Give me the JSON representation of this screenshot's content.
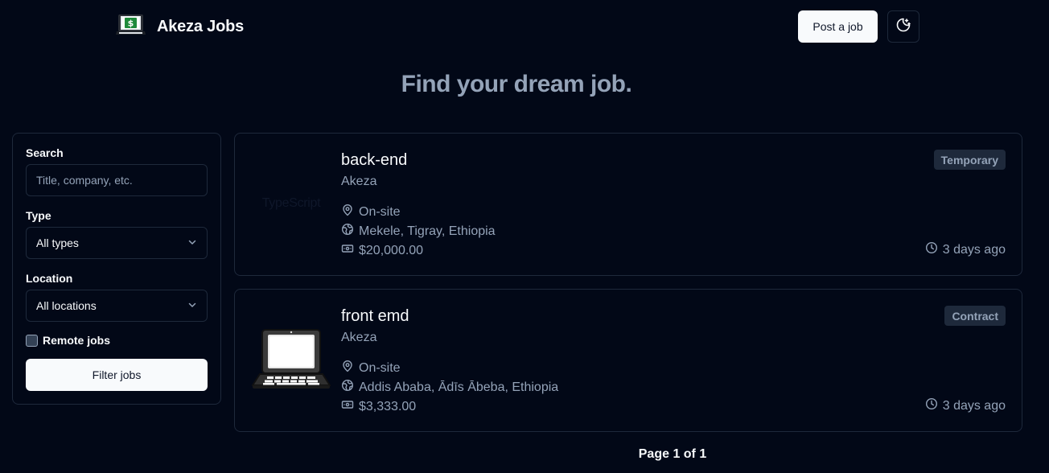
{
  "header": {
    "brand_name": "Akeza Jobs",
    "post_button_label": "Post a job"
  },
  "hero": {
    "title": "Find your dream job."
  },
  "filters": {
    "search_label": "Search",
    "search_placeholder": "Title, company, etc.",
    "search_value": "",
    "type_label": "Type",
    "type_value": "All types",
    "location_label": "Location",
    "location_value": "All locations",
    "remote_label": "Remote jobs",
    "remote_checked": false,
    "filter_button_label": "Filter jobs"
  },
  "jobs": [
    {
      "title": "back-end",
      "company": "Akeza",
      "location_type": "On-site",
      "location": "Mekele, Tigray, Ethiopia",
      "salary": "$20,000.00",
      "employment_type": "Temporary",
      "posted": "3 days ago",
      "logo_text": "TypeScript"
    },
    {
      "title": "front emd",
      "company": "Akeza",
      "location_type": "On-site",
      "location": "Addis Ababa, Ādīs Ābeba, Ethiopia",
      "salary": "$3,333.00",
      "employment_type": "Contract",
      "posted": "3 days ago",
      "logo_icon": "laptop-icon"
    }
  ],
  "pagination": {
    "text": "Page 1 of 1"
  },
  "colors": {
    "background": "#020817",
    "border": "#1e293b",
    "muted_text": "#94a3b8",
    "primary_button": "#f8fafc"
  }
}
